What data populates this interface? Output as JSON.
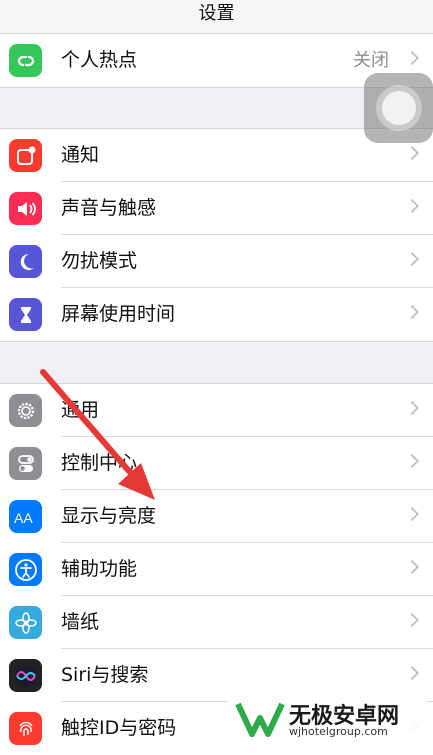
{
  "nav": {
    "title": "设置"
  },
  "groups": [
    {
      "items": [
        {
          "label": "个人热点",
          "value": "关闭",
          "icon": "hotspot-icon",
          "color": "#34c759"
        }
      ]
    },
    {
      "items": [
        {
          "label": "通知",
          "icon": "notifications-icon",
          "color": "#ff3b30"
        },
        {
          "label": "声音与触感",
          "icon": "sound-icon",
          "color": "#ff2d55"
        },
        {
          "label": "勿扰模式",
          "icon": "moon-icon",
          "color": "#5856d6"
        },
        {
          "label": "屏幕使用时间",
          "icon": "hourglass-icon",
          "color": "#5856d6"
        }
      ]
    },
    {
      "items": [
        {
          "label": "通用",
          "icon": "gear-icon",
          "color": "#8e8e93"
        },
        {
          "label": "控制中心",
          "icon": "toggles-icon",
          "color": "#8e8e93"
        },
        {
          "label": "显示与亮度",
          "icon": "display-aa-icon",
          "color": "#007aff"
        },
        {
          "label": "辅助功能",
          "icon": "accessibility-icon",
          "color": "#007aff"
        },
        {
          "label": "墙纸",
          "icon": "flower-icon",
          "color": "#35aadc"
        },
        {
          "label": "Siri与搜索",
          "icon": "siri-icon",
          "color": "#222222"
        },
        {
          "label": "触控ID与密码",
          "icon": "fingerprint-icon",
          "color": "#ff3b30"
        }
      ]
    }
  ],
  "overlay": {
    "annotation_arrow_color": "#e53935"
  },
  "watermark": {
    "title": "无极安卓网",
    "url": "wjhotelgroup.com"
  }
}
